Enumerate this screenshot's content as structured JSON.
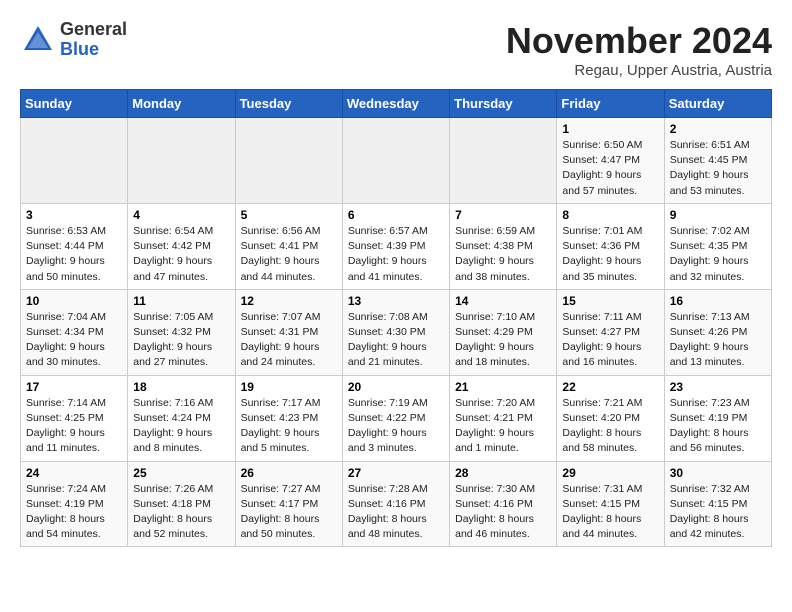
{
  "logo": {
    "general": "General",
    "blue": "Blue"
  },
  "title": "November 2024",
  "subtitle": "Regau, Upper Austria, Austria",
  "headers": [
    "Sunday",
    "Monday",
    "Tuesday",
    "Wednesday",
    "Thursday",
    "Friday",
    "Saturday"
  ],
  "weeks": [
    [
      {
        "day": "",
        "detail": ""
      },
      {
        "day": "",
        "detail": ""
      },
      {
        "day": "",
        "detail": ""
      },
      {
        "day": "",
        "detail": ""
      },
      {
        "day": "",
        "detail": ""
      },
      {
        "day": "1",
        "detail": "Sunrise: 6:50 AM\nSunset: 4:47 PM\nDaylight: 9 hours and 57 minutes."
      },
      {
        "day": "2",
        "detail": "Sunrise: 6:51 AM\nSunset: 4:45 PM\nDaylight: 9 hours and 53 minutes."
      }
    ],
    [
      {
        "day": "3",
        "detail": "Sunrise: 6:53 AM\nSunset: 4:44 PM\nDaylight: 9 hours and 50 minutes."
      },
      {
        "day": "4",
        "detail": "Sunrise: 6:54 AM\nSunset: 4:42 PM\nDaylight: 9 hours and 47 minutes."
      },
      {
        "day": "5",
        "detail": "Sunrise: 6:56 AM\nSunset: 4:41 PM\nDaylight: 9 hours and 44 minutes."
      },
      {
        "day": "6",
        "detail": "Sunrise: 6:57 AM\nSunset: 4:39 PM\nDaylight: 9 hours and 41 minutes."
      },
      {
        "day": "7",
        "detail": "Sunrise: 6:59 AM\nSunset: 4:38 PM\nDaylight: 9 hours and 38 minutes."
      },
      {
        "day": "8",
        "detail": "Sunrise: 7:01 AM\nSunset: 4:36 PM\nDaylight: 9 hours and 35 minutes."
      },
      {
        "day": "9",
        "detail": "Sunrise: 7:02 AM\nSunset: 4:35 PM\nDaylight: 9 hours and 32 minutes."
      }
    ],
    [
      {
        "day": "10",
        "detail": "Sunrise: 7:04 AM\nSunset: 4:34 PM\nDaylight: 9 hours and 30 minutes."
      },
      {
        "day": "11",
        "detail": "Sunrise: 7:05 AM\nSunset: 4:32 PM\nDaylight: 9 hours and 27 minutes."
      },
      {
        "day": "12",
        "detail": "Sunrise: 7:07 AM\nSunset: 4:31 PM\nDaylight: 9 hours and 24 minutes."
      },
      {
        "day": "13",
        "detail": "Sunrise: 7:08 AM\nSunset: 4:30 PM\nDaylight: 9 hours and 21 minutes."
      },
      {
        "day": "14",
        "detail": "Sunrise: 7:10 AM\nSunset: 4:29 PM\nDaylight: 9 hours and 18 minutes."
      },
      {
        "day": "15",
        "detail": "Sunrise: 7:11 AM\nSunset: 4:27 PM\nDaylight: 9 hours and 16 minutes."
      },
      {
        "day": "16",
        "detail": "Sunrise: 7:13 AM\nSunset: 4:26 PM\nDaylight: 9 hours and 13 minutes."
      }
    ],
    [
      {
        "day": "17",
        "detail": "Sunrise: 7:14 AM\nSunset: 4:25 PM\nDaylight: 9 hours and 11 minutes."
      },
      {
        "day": "18",
        "detail": "Sunrise: 7:16 AM\nSunset: 4:24 PM\nDaylight: 9 hours and 8 minutes."
      },
      {
        "day": "19",
        "detail": "Sunrise: 7:17 AM\nSunset: 4:23 PM\nDaylight: 9 hours and 5 minutes."
      },
      {
        "day": "20",
        "detail": "Sunrise: 7:19 AM\nSunset: 4:22 PM\nDaylight: 9 hours and 3 minutes."
      },
      {
        "day": "21",
        "detail": "Sunrise: 7:20 AM\nSunset: 4:21 PM\nDaylight: 9 hours and 1 minute."
      },
      {
        "day": "22",
        "detail": "Sunrise: 7:21 AM\nSunset: 4:20 PM\nDaylight: 8 hours and 58 minutes."
      },
      {
        "day": "23",
        "detail": "Sunrise: 7:23 AM\nSunset: 4:19 PM\nDaylight: 8 hours and 56 minutes."
      }
    ],
    [
      {
        "day": "24",
        "detail": "Sunrise: 7:24 AM\nSunset: 4:19 PM\nDaylight: 8 hours and 54 minutes."
      },
      {
        "day": "25",
        "detail": "Sunrise: 7:26 AM\nSunset: 4:18 PM\nDaylight: 8 hours and 52 minutes."
      },
      {
        "day": "26",
        "detail": "Sunrise: 7:27 AM\nSunset: 4:17 PM\nDaylight: 8 hours and 50 minutes."
      },
      {
        "day": "27",
        "detail": "Sunrise: 7:28 AM\nSunset: 4:16 PM\nDaylight: 8 hours and 48 minutes."
      },
      {
        "day": "28",
        "detail": "Sunrise: 7:30 AM\nSunset: 4:16 PM\nDaylight: 8 hours and 46 minutes."
      },
      {
        "day": "29",
        "detail": "Sunrise: 7:31 AM\nSunset: 4:15 PM\nDaylight: 8 hours and 44 minutes."
      },
      {
        "day": "30",
        "detail": "Sunrise: 7:32 AM\nSunset: 4:15 PM\nDaylight: 8 hours and 42 minutes."
      }
    ]
  ]
}
